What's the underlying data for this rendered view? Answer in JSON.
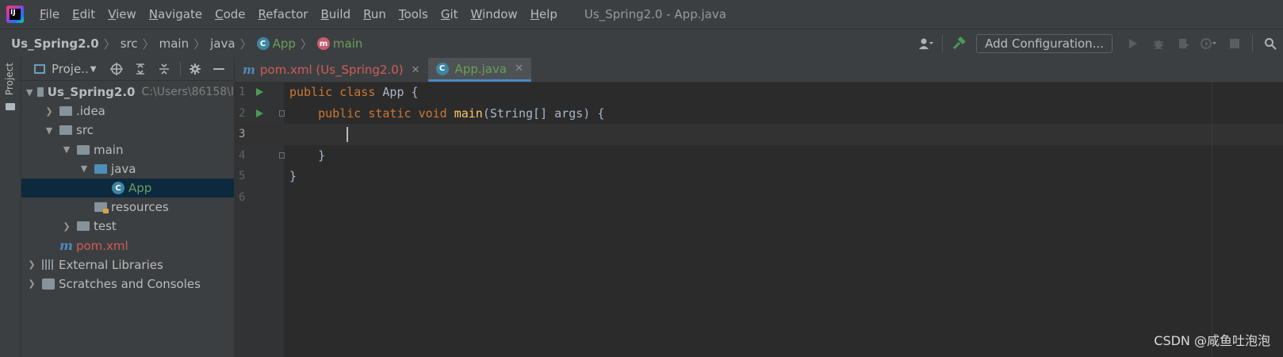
{
  "menu": {
    "items": [
      {
        "u": "F",
        "rest": "ile"
      },
      {
        "u": "E",
        "rest": "dit"
      },
      {
        "u": "V",
        "rest": "iew"
      },
      {
        "u": "N",
        "rest": "avigate"
      },
      {
        "u": "C",
        "rest": "ode"
      },
      {
        "u": "R",
        "rest": "efactor"
      },
      {
        "u": "B",
        "rest": "uild"
      },
      {
        "u": "R",
        "rest": "un",
        "pre": ""
      },
      {
        "u": "T",
        "rest": "ools"
      },
      {
        "u": "G",
        "rest": "it"
      },
      {
        "u": "W",
        "rest": "indow"
      },
      {
        "u": "H",
        "rest": "elp"
      }
    ],
    "window_title": "Us_Spring2.0 - App.java"
  },
  "breadcrumb": {
    "project": "Us_Spring2.0",
    "src": "src",
    "main": "main",
    "java": "java",
    "class": "App",
    "method": "main"
  },
  "toolbar": {
    "add_configuration": "Add Configuration..."
  },
  "project_panel": {
    "title": "Proje..",
    "tree": {
      "root_label": "Us_Spring2.0",
      "root_path": "C:\\Users\\86158\\I",
      "idea": ".idea",
      "src": "src",
      "main": "main",
      "java": "java",
      "app": "App",
      "resources": "resources",
      "test": "test",
      "pom": "pom.xml",
      "external_libraries": "External Libraries",
      "scratches": "Scratches and Consoles"
    },
    "stripe_label": "Project"
  },
  "tabs": [
    {
      "label": "pom.xml (Us_Spring2.0)",
      "icon": "maven-m-icon"
    },
    {
      "label": "App.java",
      "icon": "class-c-icon"
    }
  ],
  "editor": {
    "line_numbers": [
      "1",
      "2",
      "3",
      "4",
      "5",
      "6"
    ],
    "code": {
      "l1_kw1": "public",
      "l1_kw2": "class",
      "l1_rest": " App {",
      "l2_kw1": "public",
      "l2_kw2": "static",
      "l2_kw3": "void",
      "l2_fn": "main",
      "l2_rest": "(String[] args) {",
      "l4": "    }",
      "l5": "}"
    }
  },
  "watermark": "CSDN @咸鱼吐泡泡",
  "colors": {
    "keyword": "#cc7832",
    "method": "#ffc66d",
    "text": "#a9b7c6",
    "class_green": "#6a9e5a",
    "maven_red": "#d25a5a"
  }
}
